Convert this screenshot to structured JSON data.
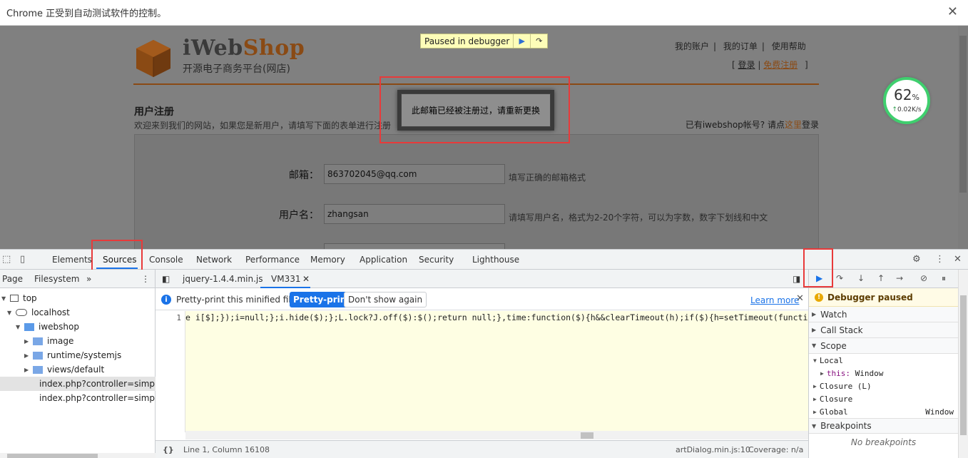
{
  "infobar": {
    "text": "Chrome 正受到自动测试软件的控制。",
    "close_icon": "close-icon"
  },
  "page": {
    "brand_i": "iWeb",
    "brand_shop": "Shop",
    "tagline": "开源电子商务平台(网店)",
    "paused_text": "Paused in debugger",
    "top_links": [
      "我的账户",
      "我的订单",
      "使用帮助"
    ],
    "auth_open": "[",
    "login": "登录",
    "register": "免费注册",
    "auth_close": "]",
    "reg_title": "用户注册",
    "reg_desc": "欢迎来到我们的网站，如果您是新用户，请填写下面的表单进行注册",
    "has_account_prefix": "已有iwebshop帐号? 请点",
    "has_account_here": "这里",
    "has_account_suffix": "登录",
    "fields": [
      {
        "label": "邮箱：",
        "value": "863702045@qq.com",
        "hint": "填写正确的邮箱格式"
      },
      {
        "label": "用户名：",
        "value": "zhangsan",
        "hint": "请填写用户名，格式为2-20个字符，可以为字数，数字下划线和中文"
      }
    ],
    "dialog_message": "此邮箱已经被注册过，请重新更换",
    "speed_percent": "62",
    "speed_unit": "%",
    "speed_rate": "0.02K/s"
  },
  "devtools": {
    "tabs": [
      "Elements",
      "Sources",
      "Console",
      "Network",
      "Performance",
      "Memory",
      "Application",
      "Security",
      "Lighthouse"
    ],
    "active_tab": "Sources",
    "nav_tabs": [
      "Page",
      "Filesystem"
    ],
    "tree": [
      {
        "label": "top",
        "depth": 0
      },
      {
        "label": "localhost",
        "depth": 1
      },
      {
        "label": "iwebshop",
        "depth": 2
      },
      {
        "label": "image",
        "depth": 3
      },
      {
        "label": "runtime/systemjs",
        "depth": 3
      },
      {
        "label": "views/default",
        "depth": 3
      },
      {
        "label": "index.php?controller=simple",
        "depth": 3
      },
      {
        "label": "index.php?controller=simple",
        "depth": 3
      }
    ],
    "editor_tabs": [
      "jquery-1.4.4.min.js",
      "VM331"
    ],
    "pretty_msg": "Pretty-print this minified file?",
    "pretty_btn": "Pretty-print",
    "dont_show": "Don't show again",
    "learn_more": "Learn more",
    "line_number": "1",
    "code": "e i[$];});i=null;};i.hide($);};L.lock?J.off($):$();return null;},time:function($){h&&clearTimeout(h);if($){h=setTimeout(function(){i",
    "status_position": "Line 1, Column 16108",
    "status_source": "artDialog.min.js:10",
    "status_coverage": "Coverage: n/a",
    "paused_banner": "Debugger paused",
    "sections": {
      "watch": "Watch",
      "call_stack": "Call Stack",
      "scope": "Scope",
      "breakpoints": "Breakpoints"
    },
    "scope": {
      "local": "Local",
      "this_key": "this:",
      "this_val": "Window",
      "closure_l": "Closure (L)",
      "closure": "Closure",
      "global": "Global",
      "global_val": "Window"
    },
    "no_breakpoints": "No breakpoints"
  }
}
